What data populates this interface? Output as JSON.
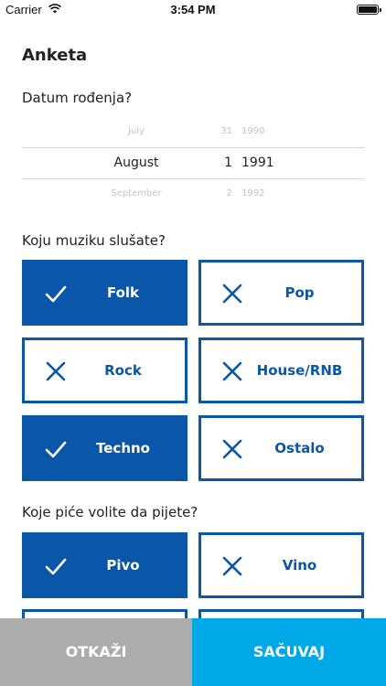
{
  "status_bar": {
    "carrier": "Carrier",
    "time": "3:54 PM"
  },
  "title": "Anketa",
  "birth_date": {
    "label": "Datum rođenja?",
    "above": {
      "month": "July",
      "day": "31",
      "year": "1990"
    },
    "selected": {
      "month": "August",
      "day": "1",
      "year": "1991"
    },
    "below": {
      "month": "September",
      "day": "2",
      "year": "1992"
    }
  },
  "music": {
    "question": "Koju muziku slušate?",
    "options": [
      {
        "label": "Folk",
        "selected": true
      },
      {
        "label": "Pop",
        "selected": false
      },
      {
        "label": "Rock",
        "selected": false
      },
      {
        "label": "House/RNB",
        "selected": false
      },
      {
        "label": "Techno",
        "selected": true
      },
      {
        "label": "Ostalo",
        "selected": false
      }
    ]
  },
  "drinks": {
    "question": "Koje piće volite da pijete?",
    "options": [
      {
        "label": "Pivo",
        "selected": true
      },
      {
        "label": "Vino",
        "selected": false
      }
    ]
  },
  "buttons": {
    "cancel": "OTKAŽI",
    "save": "SAČUVAJ"
  },
  "colors": {
    "accent": "#0a56a8",
    "cancel": "#acacac",
    "save": "#00a8e8"
  }
}
